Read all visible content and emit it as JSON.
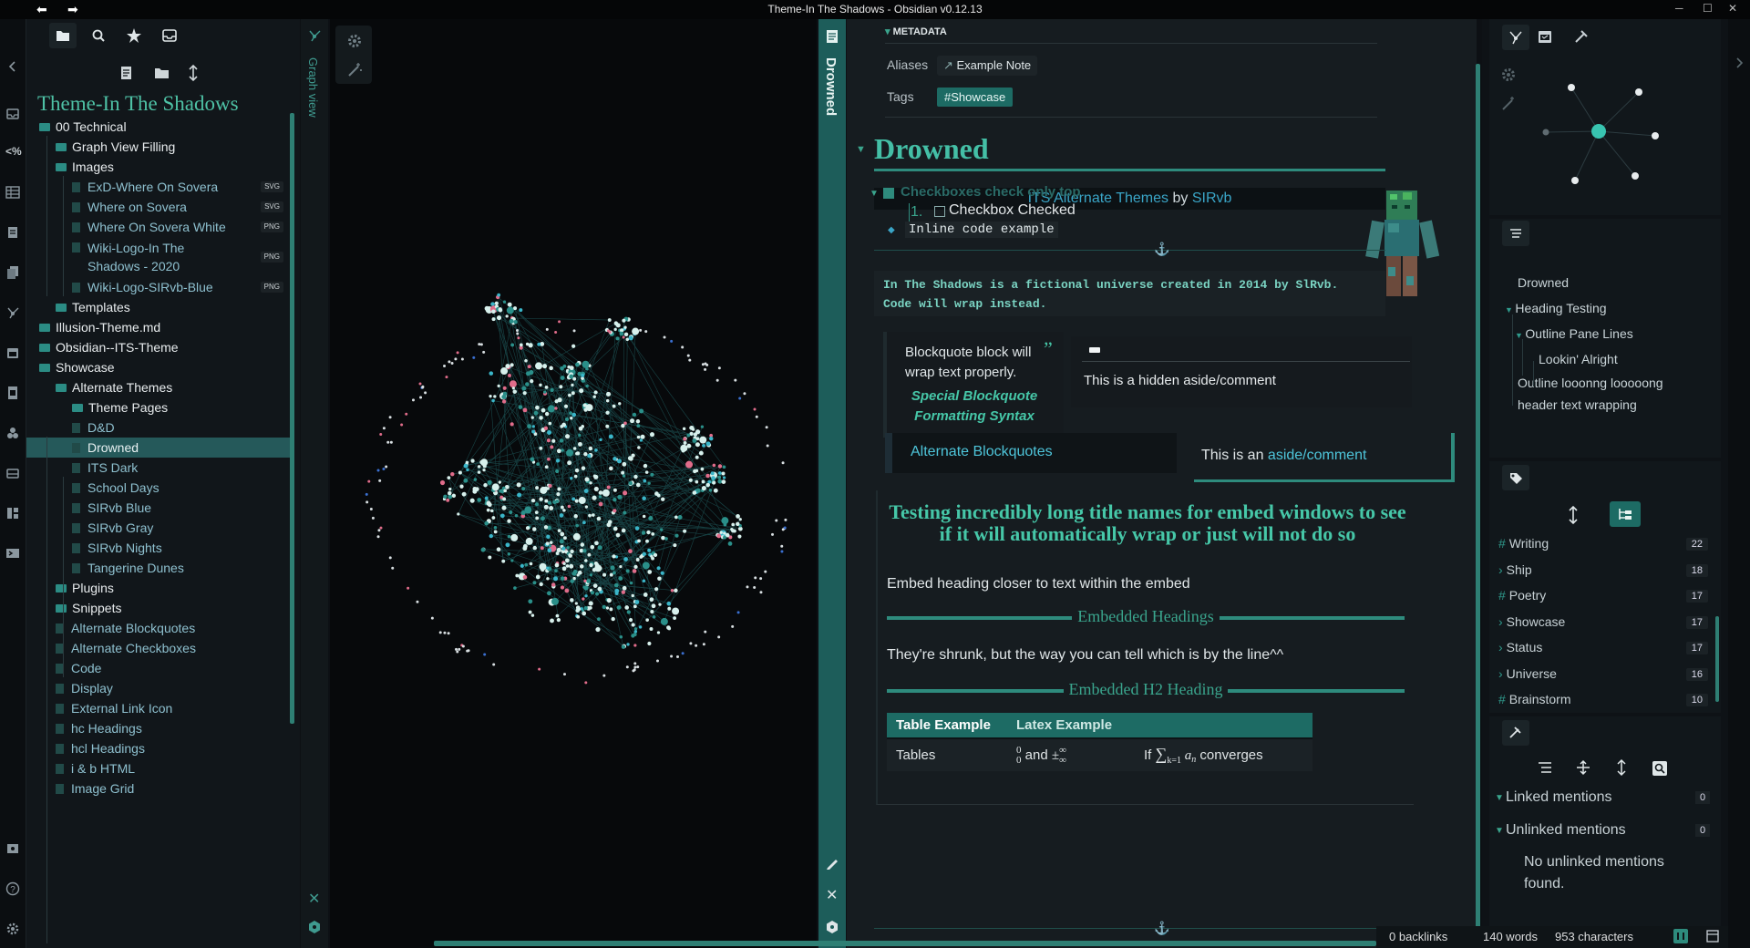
{
  "window": {
    "title": "Theme-In The Shadows - Obsidian v0.12.13",
    "back_icon": "back-arrow-icon",
    "forward_icon": "forward-arrow-icon",
    "minimize": "─",
    "maximize": "☐",
    "close": "✕"
  },
  "colors": {
    "accent": "#2e8b7d",
    "heading": "#44bfa6",
    "background": "#0d1014",
    "active_row": "#25595a"
  },
  "ribbon": {
    "icons": [
      "collapse-left-icon",
      "inbox-icon",
      "percent-code-icon",
      "table-icon",
      "note-icon",
      "copy-icon",
      "graph-icon",
      "calendar-icon",
      "files-icon",
      "plugin-icon",
      "drive-icon",
      "layout-icon",
      "terminal-icon",
      "vault-icon",
      "help-icon",
      "settings-icon"
    ]
  },
  "left_sidebar": {
    "tabs": [
      "folder-icon",
      "search-icon",
      "star-icon",
      "inbox-icon"
    ],
    "actions": [
      "new-note-icon",
      "new-folder-icon",
      "sort-icon"
    ],
    "vault_title": "Theme-In The Shadows",
    "tree": [
      {
        "label": "00 Technical",
        "type": "folder",
        "depth": 0
      },
      {
        "label": "Graph View Filling",
        "type": "folder",
        "depth": 1
      },
      {
        "label": "Images",
        "type": "folder",
        "depth": 1
      },
      {
        "label": "ExD-Where On Sovera",
        "type": "file",
        "depth": 2,
        "ext": "SVG"
      },
      {
        "label": "Where on Sovera",
        "type": "file",
        "depth": 2,
        "ext": "SVG"
      },
      {
        "label": "Where On Sovera White",
        "type": "file",
        "depth": 2,
        "ext": "PNG"
      },
      {
        "label": "Wiki-Logo-In The Shadows - 2020",
        "type": "file2",
        "depth": 2,
        "ext": "PNG",
        "line1": "Wiki-Logo-In The",
        "line2": "Shadows - 2020"
      },
      {
        "label": "Wiki-Logo-SIRvb-Blue",
        "type": "file",
        "depth": 2,
        "ext": "PNG"
      },
      {
        "label": "Templates",
        "type": "folder",
        "depth": 1
      },
      {
        "label": "Illusion-Theme.md",
        "type": "folder",
        "depth": 0
      },
      {
        "label": "Obsidian--ITS-Theme",
        "type": "folder",
        "depth": 0
      },
      {
        "label": "Showcase",
        "type": "folder",
        "depth": 0
      },
      {
        "label": "Alternate Themes",
        "type": "folder",
        "depth": 1
      },
      {
        "label": "Theme Pages",
        "type": "folder",
        "depth": 2
      },
      {
        "label": "D&D",
        "type": "file",
        "depth": 2
      },
      {
        "label": "Drowned",
        "type": "file",
        "depth": 2,
        "active": true
      },
      {
        "label": "ITS Dark",
        "type": "file",
        "depth": 2
      },
      {
        "label": "School Days",
        "type": "file",
        "depth": 2
      },
      {
        "label": "SIRvb Blue",
        "type": "file",
        "depth": 2
      },
      {
        "label": "SIRvb Gray",
        "type": "file",
        "depth": 2
      },
      {
        "label": "SIRvb Nights",
        "type": "file",
        "depth": 2
      },
      {
        "label": "Tangerine Dunes",
        "type": "file",
        "depth": 2
      },
      {
        "label": "Plugins",
        "type": "folder",
        "depth": 1
      },
      {
        "label": "Snippets",
        "type": "folder",
        "depth": 1
      },
      {
        "label": "Alternate Blockquotes",
        "type": "file",
        "depth": 1
      },
      {
        "label": "Alternate Checkboxes",
        "type": "file",
        "depth": 1
      },
      {
        "label": "Code",
        "type": "file",
        "depth": 1
      },
      {
        "label": "Display",
        "type": "file",
        "depth": 1
      },
      {
        "label": "External Link Icon",
        "type": "file",
        "depth": 1
      },
      {
        "label": "hc Headings",
        "type": "file",
        "depth": 1
      },
      {
        "label": "hcl Headings",
        "type": "file",
        "depth": 1
      },
      {
        "label": "i & b HTML",
        "type": "file",
        "depth": 1
      },
      {
        "label": "Image Grid",
        "type": "file",
        "depth": 1
      }
    ]
  },
  "graph": {
    "header_label": "Graph view",
    "header_icon": "graph-icon",
    "tools": [
      "settings-icon",
      "wand-icon"
    ],
    "footer_icons": [
      "close-icon",
      "hex-icon"
    ]
  },
  "editor": {
    "header_label": "Drowned",
    "header_icon": "note-icon",
    "metadata_label": "METADATA",
    "aliases_label": "Aliases",
    "alias_value": "Example Note",
    "tags_label": "Tags",
    "tag_value": "#Showcase",
    "heading": "Drowned",
    "banner": {
      "part1": "ITS Alternate Themes",
      "part2": " by ",
      "part3": "SIRvb"
    },
    "checkbox_title": "Checkboxes check only top",
    "checkbox_item_num": "1.",
    "checkbox_item": "Checkbox Checked",
    "inline_code": "Inline code example",
    "code_block_line1": "In The Shadows is a fictional universe created in 2014 by SlRvb.",
    "code_block_line2": "Code will wrap instead.",
    "quote_line1": "Blockquote block will",
    "quote_line2": "wrap text properly.",
    "quote_special1": "Special Blockquote",
    "quote_special2": "Formatting Syntax",
    "hidden_aside": "This is a hidden aside/comment",
    "alt_blockquotes": "Alternate Blockquotes",
    "aside_prefix": "This is an ",
    "aside_link": "aside/comment",
    "embed_title": "Testing incredibly long title names for embed windows to see if it will automatically wrap or just will not do so",
    "embed_text1": "Embed heading closer to text within the embed",
    "embedded_headings": "Embedded Headings",
    "embed_text2": "They're shrunk, but the way you can tell which is by the line^^",
    "embedded_h2": "Embedded H2 Heading",
    "table": {
      "headers": [
        "Table Example",
        "Latex Example",
        ""
      ],
      "row": [
        "Tables",
        "and",
        "If",
        "converges"
      ]
    },
    "side_icons": [
      "edit-icon",
      "close-icon",
      "hex-icon"
    ]
  },
  "right_sidebar": {
    "top_tabs": [
      "graph-icon",
      "calendar-icon",
      "tools-icon"
    ],
    "outline": [
      {
        "label": "Drowned",
        "level": 1
      },
      {
        "label": "Heading Testing",
        "level": 1,
        "collapsible": true
      },
      {
        "label": "Outline Pane Lines",
        "level": 2,
        "collapsible": true
      },
      {
        "label": "Lookin' Alright",
        "level": 3
      },
      {
        "label": "Outline looonng looooong header text wrapping",
        "level": 1,
        "line1": "Outline looonng looooong",
        "line2": "header text wrapping"
      }
    ],
    "tags": [
      {
        "name": "Writing",
        "count": "22",
        "prefix": "#"
      },
      {
        "name": "Ship",
        "count": "18",
        "prefix": "›"
      },
      {
        "name": "Poetry",
        "count": "17",
        "prefix": "#"
      },
      {
        "name": "Showcase",
        "count": "17",
        "prefix": "›"
      },
      {
        "name": "Status",
        "count": "17",
        "prefix": "›"
      },
      {
        "name": "Universe",
        "count": "16",
        "prefix": "›"
      },
      {
        "name": "Brainstorm",
        "count": "10",
        "prefix": "#"
      }
    ],
    "linked_mentions": "Linked mentions",
    "linked_count": "0",
    "unlinked_mentions": "Unlinked mentions",
    "unlinked_count": "0",
    "no_unlinked_line1": "No unlinked mentions",
    "no_unlinked_line2": "found."
  },
  "status": {
    "backlinks": "0 backlinks",
    "words": "140 words",
    "characters": "953 characters"
  }
}
